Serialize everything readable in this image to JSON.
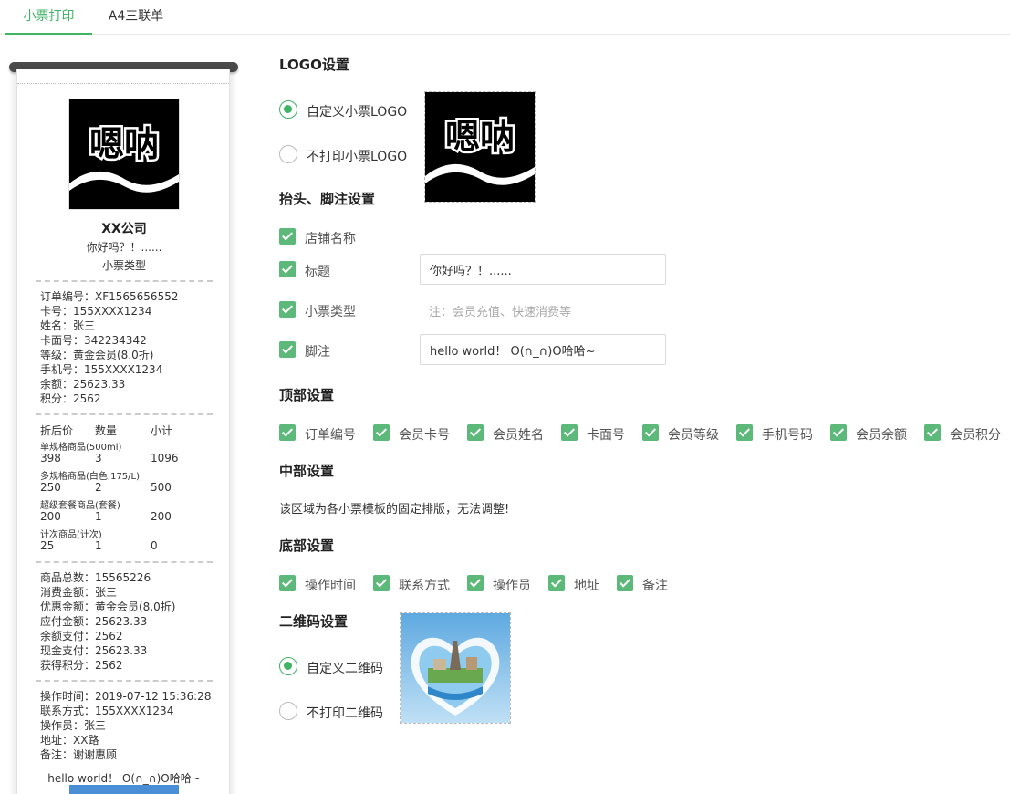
{
  "tabs": [
    "小票打印",
    "A4三联单"
  ],
  "receipt": {
    "logo_text": "嗯呐",
    "company": "XX公司",
    "title": "你好吗？！......",
    "type": "小票类型",
    "header_lines": [
      "订单编号：XF1565656552",
      "卡号：155XXXX1234",
      "姓名：张三",
      "卡面号：342234342",
      "等级：黄金会员(8.0折)",
      "手机号：155XXXX1234",
      "余额：25623.33",
      "积分：2562"
    ],
    "item_headers": [
      "折后价",
      "数量",
      "小计"
    ],
    "items": [
      {
        "name": "单规格商品(500ml)",
        "price": "398",
        "qty": "3",
        "total": "1096"
      },
      {
        "name": "多规格商品(白色,175/L)",
        "price": "250",
        "qty": "2",
        "total": "500"
      },
      {
        "name": "超级套餐商品(套餐)",
        "price": "200",
        "qty": "1",
        "total": "200"
      },
      {
        "name": "计次商品(计次)",
        "price": "25",
        "qty": "1",
        "total": "0"
      }
    ],
    "summary_lines": [
      "商品总数：15565226",
      "消费金额：张三",
      "优惠金额：黄金会员(8.0折)",
      "应付金额：25623.33",
      "余额支付：2562",
      "现金支付：25623.33",
      "获得积分：2562"
    ],
    "footer_lines": [
      "操作时间：2019-07-12 15:36:28",
      "联系方式：155XXXX1234",
      "操作员：张三",
      "地址：XX路",
      "备注：谢谢惠顾"
    ],
    "footer_text": "hello world！ O(∩_∩)O哈哈~"
  },
  "settings": {
    "logo": {
      "heading": "LOGO设置",
      "custom_label": "自定义小票LOGO",
      "none_label": "不打印小票LOGO",
      "logo_text": "嗯呐"
    },
    "header_footer": {
      "heading": "抬头、脚注设置",
      "store_name": "店铺名称",
      "title_label": "标题",
      "title_value": "你好吗？！......",
      "type_label": "小票类型",
      "type_placeholder": "注：会员充值、快速消费等",
      "footer_label": "脚注",
      "footer_value": "hello world！ O(∩_∩)O哈哈~"
    },
    "top": {
      "heading": "顶部设置",
      "items": [
        "订单编号",
        "会员卡号",
        "会员姓名",
        "卡面号",
        "会员等级",
        "手机号码",
        "会员余额",
        "会员积分"
      ]
    },
    "middle": {
      "heading": "中部设置",
      "note": "该区域为各小票模板的固定排版，无法调整!"
    },
    "bottom": {
      "heading": "底部设置",
      "items": [
        "操作时间",
        "联系方式",
        "操作员",
        "地址",
        "备注"
      ]
    },
    "qr": {
      "heading": "二维码设置",
      "custom_label": "自定义二维码",
      "none_label": "不打印二维码"
    }
  },
  "colors": {
    "accent": "#3fb465",
    "checkbox": "#5cb97a"
  }
}
